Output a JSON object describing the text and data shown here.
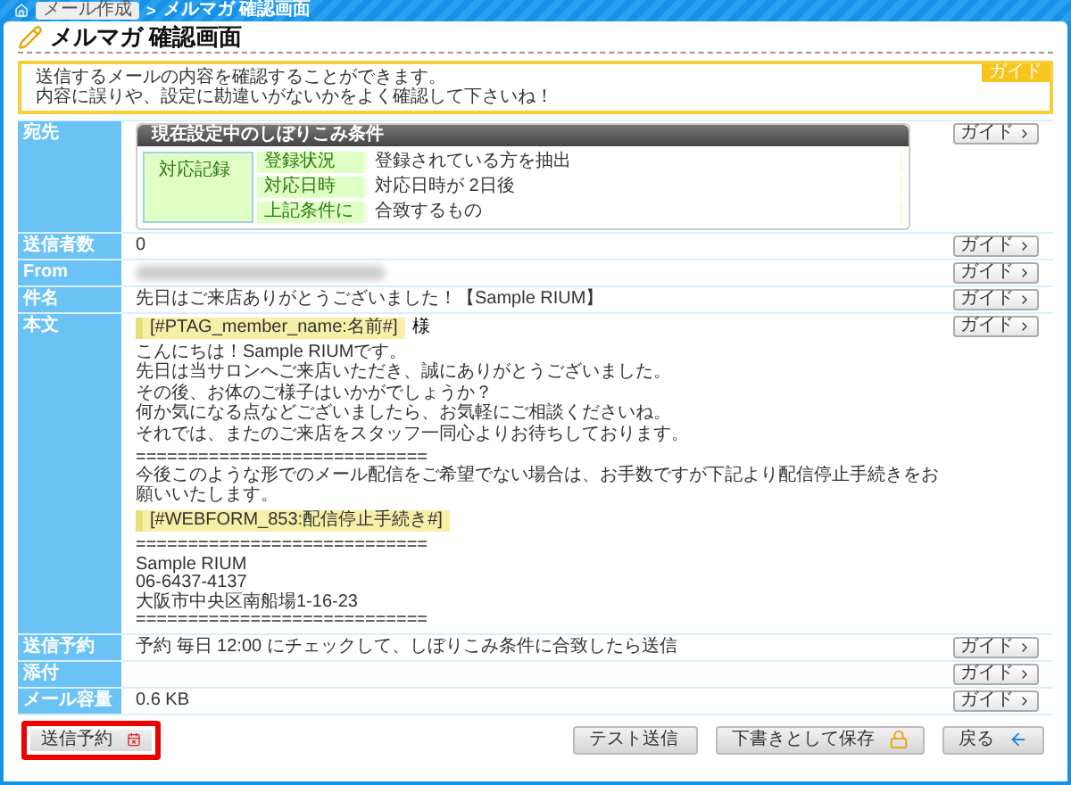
{
  "breadcrumb": {
    "link": "メール作成",
    "separator": ">",
    "current": "メルマガ 確認画面"
  },
  "page_title": "メルマガ 確認画面",
  "notice": {
    "badge": "ガイド",
    "lines": [
      "送信するメールの内容を確認することができます。",
      "内容に誤りや、設定に勘違いがないかをよく確認して下さいね！"
    ]
  },
  "fields": [
    {
      "kind": "filter",
      "label": "宛先",
      "guide": "ガイド",
      "filter": {
        "title": "現在設定中のしぼりこみ条件",
        "side_label": "対応記録",
        "rows": [
          {
            "label": "登録状況",
            "value": "登録されている方を抽出"
          },
          {
            "label": "対応日時",
            "value": "対応日時が 2日後"
          },
          {
            "label": "上記条件に",
            "value": "合致するもの"
          }
        ]
      }
    },
    {
      "kind": "text",
      "label": "送信者数",
      "value": "0",
      "guide": "ガイド"
    },
    {
      "kind": "blurred",
      "label": "From",
      "guide": "ガイド"
    },
    {
      "kind": "text",
      "label": "件名",
      "value": "先日はご来店ありがとうございました！【Sample RIUM】",
      "guide": "ガイド"
    },
    {
      "kind": "body",
      "label": "本文",
      "guide": "ガイド",
      "body": [
        {
          "kind": "tag",
          "text": "[#PTAG_member_name:名前#]",
          "suffix": "様"
        },
        {
          "kind": "text",
          "lines": [
            "こんにちは！Sample RIUMです。",
            "先日は当サロンへご来店いただき、誠にありがとうございました。"
          ]
        },
        {
          "kind": "text",
          "lines": [
            "その後、お体のご様子はいかがでしょうか？",
            "何か気になる点などございましたら、お気軽にご相談くださいね。"
          ]
        },
        {
          "kind": "text",
          "lines": [
            "それでは、またのご来店をスタッフ一同心よりお待ちしております。"
          ]
        },
        {
          "kind": "text",
          "lines": [
            "============================",
            "今後このような形でのメール配信をご希望でない場合は、お手数ですが下記より配信停止手続きをお願いいたします。"
          ]
        },
        {
          "kind": "tag",
          "text": "[#WEBFORM_853:配信停止手続き#]"
        },
        {
          "kind": "text",
          "lines": [
            "============================",
            "Sample RIUM",
            "06-6437-4137",
            "大阪市中央区南船場1-16-23",
            "============================"
          ]
        }
      ]
    },
    {
      "kind": "text",
      "label": "送信予約",
      "value": "予約 毎日 12:00 にチェックして、しぼりこみ条件に合致したら送信",
      "guide": "ガイド"
    },
    {
      "kind": "text",
      "label": "添付",
      "guide": "ガイド"
    },
    {
      "kind": "text",
      "label": "メール容量",
      "value": "0.6 KB",
      "guide": "ガイド"
    }
  ],
  "buttons": [
    {
      "kind": "schedule",
      "label": "送信予約",
      "highlighted": true
    },
    {
      "kind": "test",
      "label": "テスト送信",
      "highlighted": false
    },
    {
      "kind": "save",
      "label": "下書きとして保存",
      "highlighted": false
    },
    {
      "kind": "back",
      "label": "戻る",
      "highlighted": false
    }
  ]
}
